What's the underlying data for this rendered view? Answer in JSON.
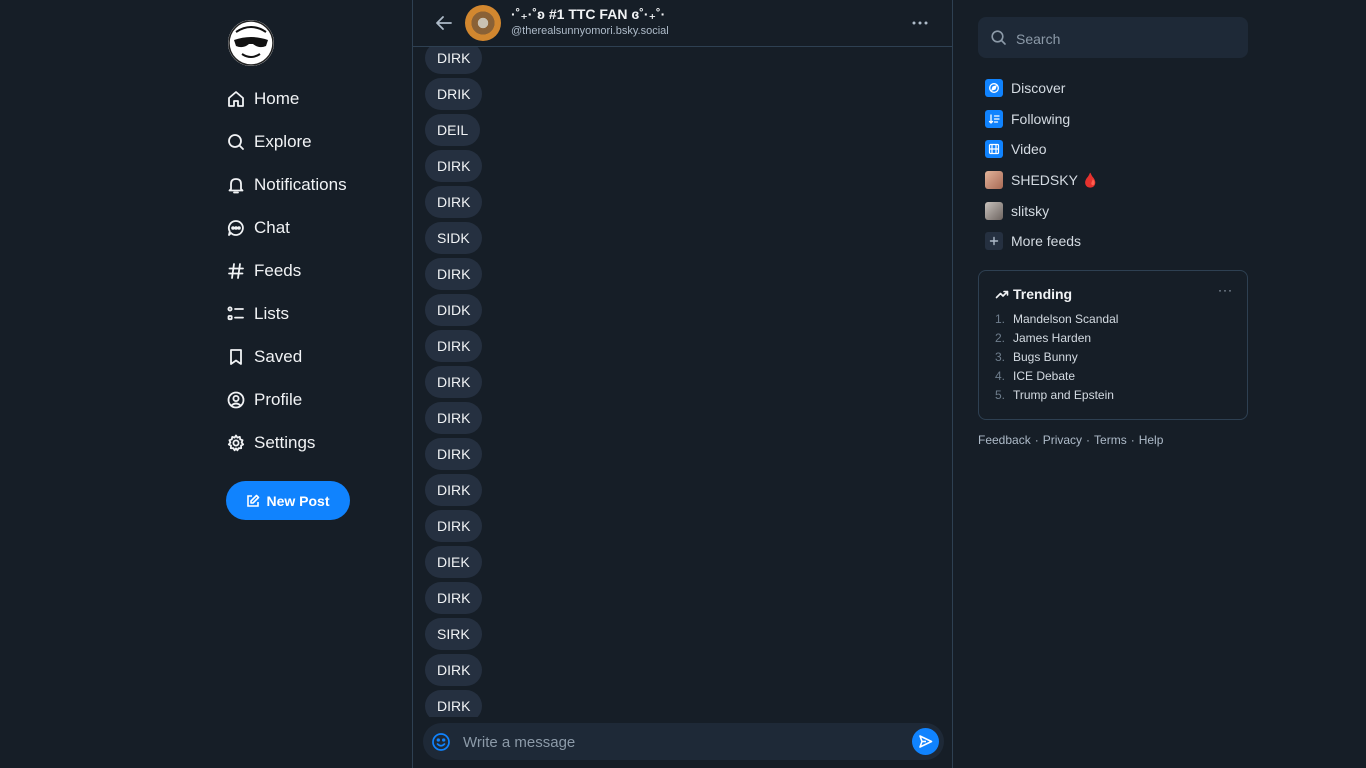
{
  "nav": {
    "items": [
      {
        "label": "Home",
        "icon": "home-icon"
      },
      {
        "label": "Explore",
        "icon": "search-icon"
      },
      {
        "label": "Notifications",
        "icon": "bell-icon"
      },
      {
        "label": "Chat",
        "icon": "chat-icon"
      },
      {
        "label": "Feeds",
        "icon": "hash-icon"
      },
      {
        "label": "Lists",
        "icon": "list-icon"
      },
      {
        "label": "Saved",
        "icon": "bookmark-icon"
      },
      {
        "label": "Profile",
        "icon": "profile-icon"
      },
      {
        "label": "Settings",
        "icon": "gear-icon"
      }
    ],
    "new_post_label": "New Post"
  },
  "conversation": {
    "name": "·˚₊·˚ʚ #1 TTC FAN ɞ˚·₊˚·",
    "handle": "@therealsunnyomori.bsky.social",
    "messages": [
      "DIRK",
      "DRIK",
      "DEIL",
      "DIRK",
      "DIRK",
      "SIDK",
      "DIRK",
      "DIDK",
      "DIRK",
      "DIRK",
      "DIRK",
      "DIRK",
      "DIRK",
      "DIRK",
      "DIEK",
      "DIRK",
      "SIRK",
      "DIRK",
      "DIRK"
    ],
    "composer_placeholder": "Write a message"
  },
  "search": {
    "placeholder": "Search"
  },
  "feeds": [
    {
      "label": "Discover",
      "icon": "discover-icon",
      "color": "#1083fe"
    },
    {
      "label": "Following",
      "icon": "following-icon",
      "color": "#1083fe"
    },
    {
      "label": "Video",
      "icon": "video-icon",
      "color": "#1083fe"
    },
    {
      "label": "SHEDSKY 🩸",
      "icon": "shedsky-avatar-icon",
      "color": "#c98e74"
    },
    {
      "label": "slitsky",
      "icon": "slitsky-avatar-icon",
      "color": "#9a8f8a"
    },
    {
      "label": "More feeds",
      "icon": "plus-icon",
      "color": "#253040"
    }
  ],
  "trending": {
    "title": "Trending",
    "more": "···",
    "items": [
      {
        "n": "1.",
        "label": "Mandelson Scandal"
      },
      {
        "n": "2.",
        "label": "James Harden"
      },
      {
        "n": "3.",
        "label": "Bugs Bunny"
      },
      {
        "n": "4.",
        "label": "ICE Debate"
      },
      {
        "n": "5.",
        "label": "Trump and Epstein"
      }
    ]
  },
  "footer": {
    "feedback": "Feedback",
    "privacy": "Privacy",
    "terms": "Terms",
    "help": "Help",
    "sep": "·"
  },
  "colors": {
    "accent": "#1083fe",
    "background": "#161e27",
    "bubble": "#253040"
  }
}
